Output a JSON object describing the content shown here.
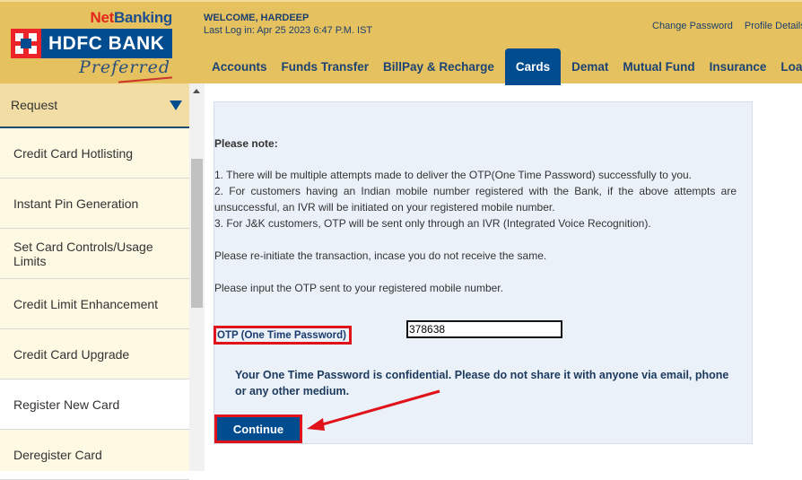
{
  "brand": {
    "net": "Net",
    "banking": "Banking",
    "bank_name": "HDFC BANK",
    "tier": "Preferred",
    "colors": {
      "header_bg": "#e6c15f",
      "primary_blue": "#004c8f",
      "red": "#e1261c"
    }
  },
  "header": {
    "welcome": "WELCOME, HARDEEP",
    "last_login": "Last Log in: Apr 25 2023 6:47 P.M. IST",
    "links": [
      "Change Password",
      "Profile Details"
    ]
  },
  "nav": {
    "items": [
      {
        "label": "Accounts",
        "active": false
      },
      {
        "label": "Funds Transfer",
        "active": false
      },
      {
        "label": "BillPay & Recharge",
        "active": false
      },
      {
        "label": "Cards",
        "active": true
      },
      {
        "label": "Demat",
        "active": false
      },
      {
        "label": "Mutual Fund",
        "active": false
      },
      {
        "label": "Insurance",
        "active": false
      },
      {
        "label": "Loans",
        "active": false
      }
    ]
  },
  "sidebar": {
    "header": "Request",
    "header_icon": "caret-down-icon",
    "items": [
      {
        "label": "Credit Card Hotlisting"
      },
      {
        "label": "Instant Pin Generation"
      },
      {
        "label": "Set Card Controls/Usage Limits"
      },
      {
        "label": "Credit Limit Enhancement"
      },
      {
        "label": "Credit Card Upgrade"
      },
      {
        "label": "Register New Card",
        "highlighted": true
      },
      {
        "label": "Deregister Card"
      }
    ]
  },
  "content": {
    "note_title": "Please note:",
    "note_lines": [
      "1. There will be multiple attempts made to deliver the OTP(One Time Password) successfully to you.",
      "2. For customers having an Indian mobile number registered with the Bank, if the above attempts are unsuccessful, an IVR will be initiated on your registered mobile number.",
      "3. For J&K customers, OTP will be sent only through an IVR (Integrated Voice Recognition)."
    ],
    "reinitiate": "Please re-initiate the transaction, incase you do not receive the same.",
    "input_hint": "Please input the OTP sent to your registered mobile number.",
    "otp_label": "OTP (One Time Password)",
    "otp_value": "378638",
    "confidential": "Your One Time Password is confidential. Please do not share it with anyone via email, phone or any other medium.",
    "continue_label": "Continue"
  },
  "annotations": {
    "highlight_color": "#e0121a",
    "arrow_target": "Continue"
  }
}
